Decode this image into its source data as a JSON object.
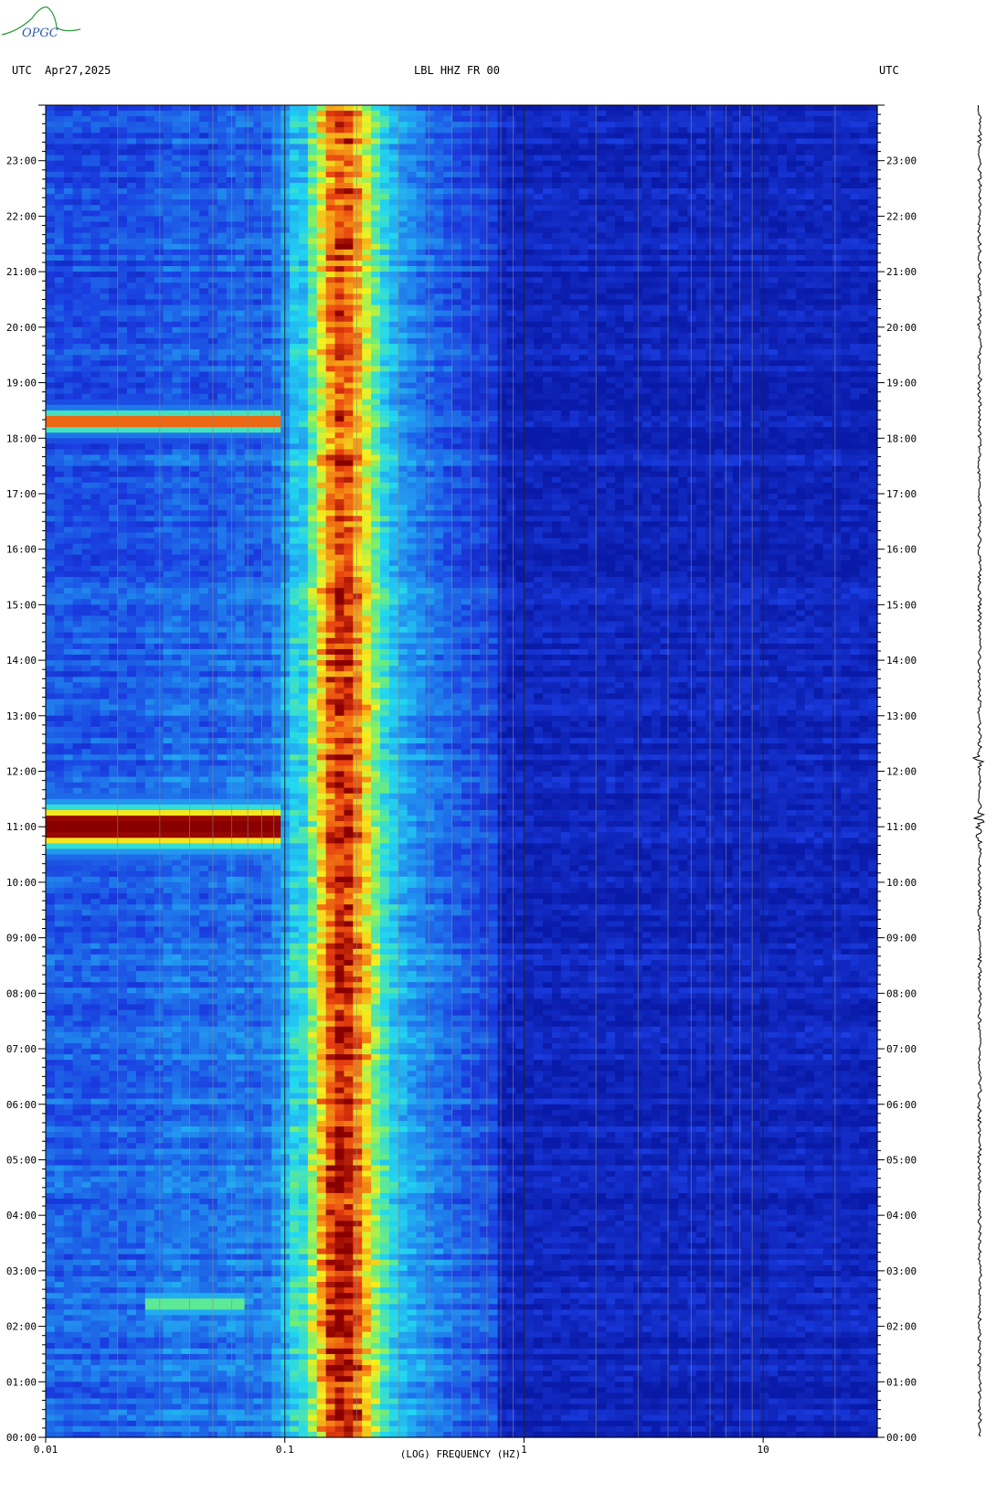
{
  "header": {
    "left_zone": "UTC",
    "date": "Apr27,2025",
    "station": "LBL HHZ FR 00",
    "right_zone": "UTC"
  },
  "logo": {
    "text": "OPGC"
  },
  "chart_data": {
    "type": "heatmap",
    "xlabel": "(LOG) FREQUENCY (HZ)",
    "x_scale": "log",
    "xlim": [
      0.01,
      30
    ],
    "x_ticks": [
      {
        "value": 0.01,
        "label": "0.01"
      },
      {
        "value": 0.1,
        "label": "0.1"
      },
      {
        "value": 1,
        "label": "1"
      },
      {
        "value": 10,
        "label": "10"
      }
    ],
    "y_ticks": [
      "00:00",
      "01:00",
      "02:00",
      "03:00",
      "04:00",
      "05:00",
      "06:00",
      "07:00",
      "08:00",
      "09:00",
      "10:00",
      "11:00",
      "12:00",
      "13:00",
      "14:00",
      "15:00",
      "16:00",
      "17:00",
      "18:00",
      "19:00",
      "20:00",
      "21:00",
      "22:00",
      "23:00"
    ],
    "ylim_hours": [
      0,
      24
    ],
    "microseism_band_hz": [
      0.13,
      0.22
    ],
    "events": [
      {
        "hour": 11.0,
        "freq_range_hz": [
          0.01,
          0.1
        ],
        "level": "very high"
      },
      {
        "hour": 18.3,
        "freq_range_hz": [
          0.01,
          0.1
        ],
        "level": "high"
      },
      {
        "hour": 2.4,
        "freq_range_hz": [
          0.025,
          0.07
        ],
        "level": "moderate"
      }
    ],
    "colors": {
      "background": "#0a1aa8",
      "low": "#1a3ce0",
      "mid": "#22d8f0",
      "high": "#f4f020",
      "peak": "#e84010",
      "max": "#8a0000"
    }
  }
}
